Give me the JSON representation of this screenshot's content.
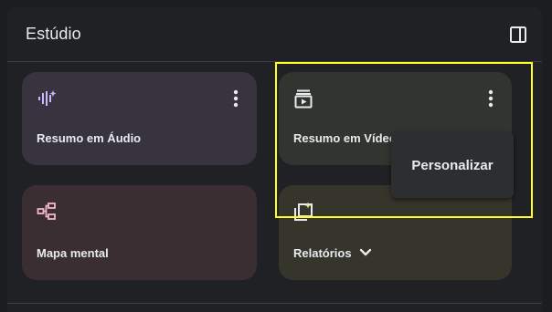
{
  "panel": {
    "title": "Estúdio",
    "toggle_icon": "side-panel-icon"
  },
  "cards": {
    "audio": {
      "label": "Resumo em Áudio",
      "icon": "audio-waveform-icon",
      "menu_icon": "more-vert-icon"
    },
    "video": {
      "label": "Resumo em Vídeo",
      "icon": "video-summary-icon",
      "menu_icon": "more-vert-icon"
    },
    "mindmap": {
      "label": "Mapa mental",
      "icon": "mind-map-icon"
    },
    "reports": {
      "label": "Relatórios",
      "icon": "reports-icon",
      "dropdown_icon": "chevron-down-icon"
    }
  },
  "popup_menu": {
    "items": [
      "Personalizar"
    ]
  },
  "colors": {
    "highlight": "#ffff26",
    "audio_icon": "#c5b9ff",
    "mindmap_icon": "#f4b6c8",
    "reports_icon": "#e8e6a0"
  }
}
